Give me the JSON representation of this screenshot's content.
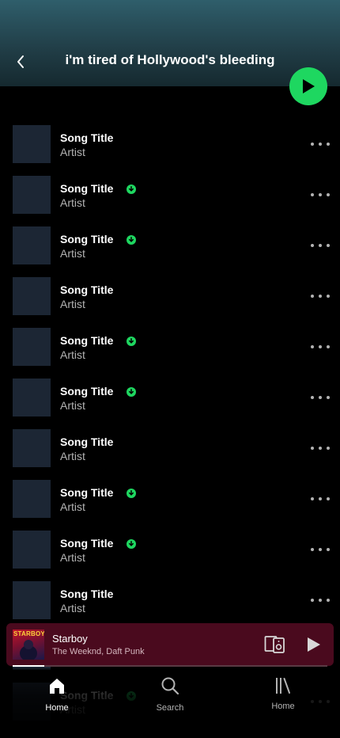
{
  "header": {
    "title": "i'm tired of Hollywood's bleeding"
  },
  "tracks": [
    {
      "title": "Song Title",
      "artist": "Artist",
      "downloaded": false
    },
    {
      "title": "Song Title",
      "artist": "Artist",
      "downloaded": true
    },
    {
      "title": "Song Title",
      "artist": "Artist",
      "downloaded": true
    },
    {
      "title": "Song Title",
      "artist": "Artist",
      "downloaded": false
    },
    {
      "title": "Song Title",
      "artist": "Artist",
      "downloaded": true
    },
    {
      "title": "Song Title",
      "artist": "Artist",
      "downloaded": true
    },
    {
      "title": "Song Title",
      "artist": "Artist",
      "downloaded": false
    },
    {
      "title": "Song Title",
      "artist": "Artist",
      "downloaded": true
    },
    {
      "title": "Song Title",
      "artist": "Artist",
      "downloaded": true
    },
    {
      "title": "Song Title",
      "artist": "Artist",
      "downloaded": false
    },
    {
      "title": "Song Title",
      "artist": "Artist",
      "downloaded": false
    },
    {
      "title": "Song Title",
      "artist": "Artist",
      "downloaded": true
    }
  ],
  "now_playing": {
    "art_text": "STARBOY",
    "title": "Starboy",
    "artist": "The Weeknd, Daft Punk",
    "progress": 0.1
  },
  "tabs": [
    {
      "label": "Home",
      "icon": "home-icon",
      "active": true
    },
    {
      "label": "Search",
      "icon": "search-icon",
      "active": false
    },
    {
      "label": "Home",
      "icon": "library-icon",
      "active": false
    }
  ],
  "colors": {
    "accent": "#1ed760",
    "header_top": "#2f5e6b",
    "mini_player_bg": "#4a0a1e",
    "thumb": "#1c2634"
  }
}
